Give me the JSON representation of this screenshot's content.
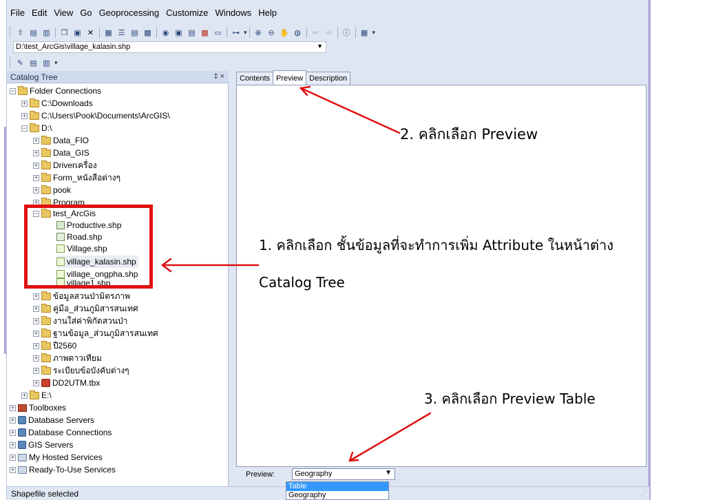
{
  "menu": [
    "File",
    "Edit",
    "View",
    "Go",
    "Geoprocessing",
    "Customize",
    "Windows",
    "Help"
  ],
  "location_path": "D:\\test_ArcGis\\village_kalasin.shp",
  "catalog": {
    "title": "Catalog Tree",
    "controls": "‡ ×"
  },
  "tree": {
    "folder_connections": "Folder Connections",
    "downloads": "C:\\Downloads",
    "arcgis_docs": "C:\\Users\\Pook\\Documents\\ArcGIS\\",
    "drive_d": "D:\\",
    "data_fio": "Data_FIO",
    "data_gis": "Data_GIS",
    "driver": "Driverเครื่อง",
    "form": "Form_หนังสือต่างๆ",
    "pook": "pook",
    "program": "Program",
    "test_arcgis": "test_ArcGis",
    "productive": "Productive.shp",
    "road": "Road.shp",
    "village": "Village.shp",
    "village_kalasin": "village_kalasin.shp",
    "village_ongpha": "village_ongpha.shp",
    "village1": "village1.shp",
    "thai1": "ข้อมูลสวนป่ามิตรภาพ",
    "thai2": "คู่มือ_ส่วนภูมิสารสนเทศ",
    "thai3": "งานใส่ค่าพิกัดสวนป่า",
    "thai4": "ฐานข้อมูล_ส่วนภูมิสารสนเทศ",
    "year": "ปื2560",
    "satellite": "ภาพดาวเทียม",
    "regulations": "ระเบียบข้อบังคับต่างๆ",
    "dd2utm": "DD2UTM.tbx",
    "drive_e": "E:\\",
    "toolboxes": "Toolboxes",
    "db_servers": "Database Servers",
    "db_connections": "Database Connections",
    "gis_servers": "GIS Servers",
    "hosted": "My Hosted Services",
    "ready": "Ready-To-Use Services"
  },
  "tabs": [
    "Contents",
    "Preview",
    "Description"
  ],
  "preview": {
    "label": "Preview:",
    "selected": "Geography",
    "options": [
      "Table",
      "Geography"
    ]
  },
  "status": "Shapefile selected",
  "annotations": {
    "step2": "2. คลิกเลือก Preview",
    "step1_line1": "1. คลิกเลือก ชั้นข้อมูลที่จะทำการเพิ่ม Attribute ในหน้าต่าง",
    "step1_line2": "Catalog Tree",
    "step3": "3. คลิกเลือก Preview Table"
  },
  "colors": {
    "annotation_red": "#e01010",
    "window_bg": "#dfe6f3",
    "selection_blue": "#3399ff"
  }
}
